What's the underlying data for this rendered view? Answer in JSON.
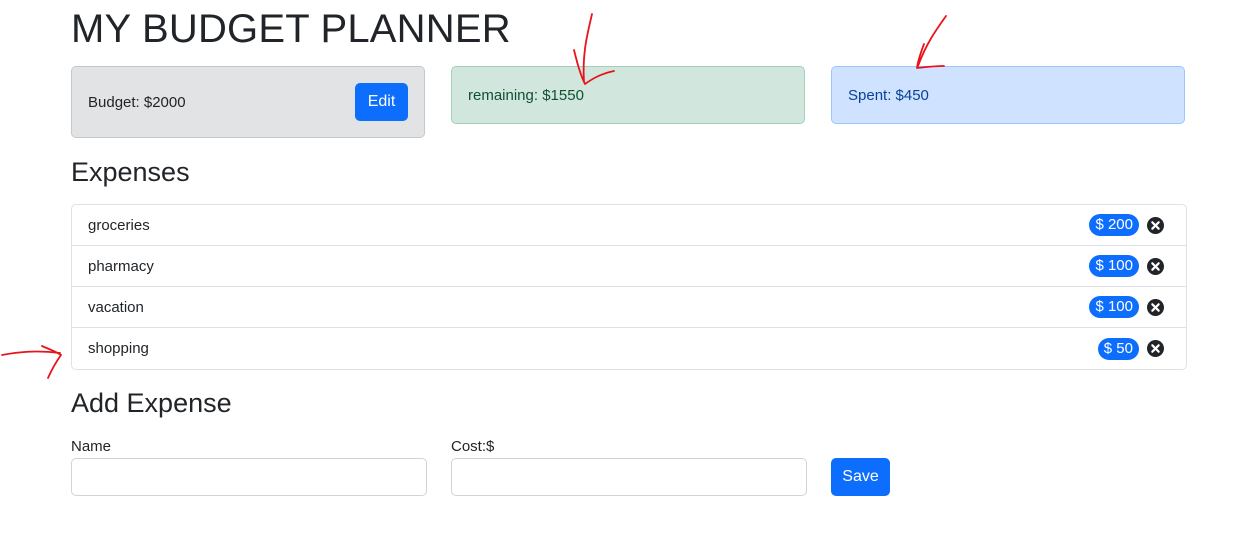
{
  "app": {
    "title": "MY BUDGET PLANNER"
  },
  "summary": {
    "budget_text": "Budget: $2000",
    "edit_label": "Edit",
    "remaining_text": "remaining: $1550",
    "spent_text": "Spent: $450"
  },
  "expenses": {
    "heading": "Expenses",
    "items": [
      {
        "name": "groceries",
        "cost": "$ 200"
      },
      {
        "name": "pharmacy",
        "cost": "$ 100"
      },
      {
        "name": "vacation",
        "cost": "$ 100"
      },
      {
        "name": "shopping",
        "cost": "$ 50"
      }
    ],
    "remove_icon": "close-circle-icon"
  },
  "add_expense": {
    "heading": "Add Expense",
    "name_label": "Name",
    "name_value": "",
    "cost_label": "Cost:$",
    "cost_value": "",
    "save_label": "Save"
  },
  "colors": {
    "primary": "#0d6efd",
    "budget_bg": "#e2e3e5",
    "remaining_bg": "#d1e7dd",
    "spent_bg": "#cfe2ff",
    "annotation": "#e8141b"
  }
}
